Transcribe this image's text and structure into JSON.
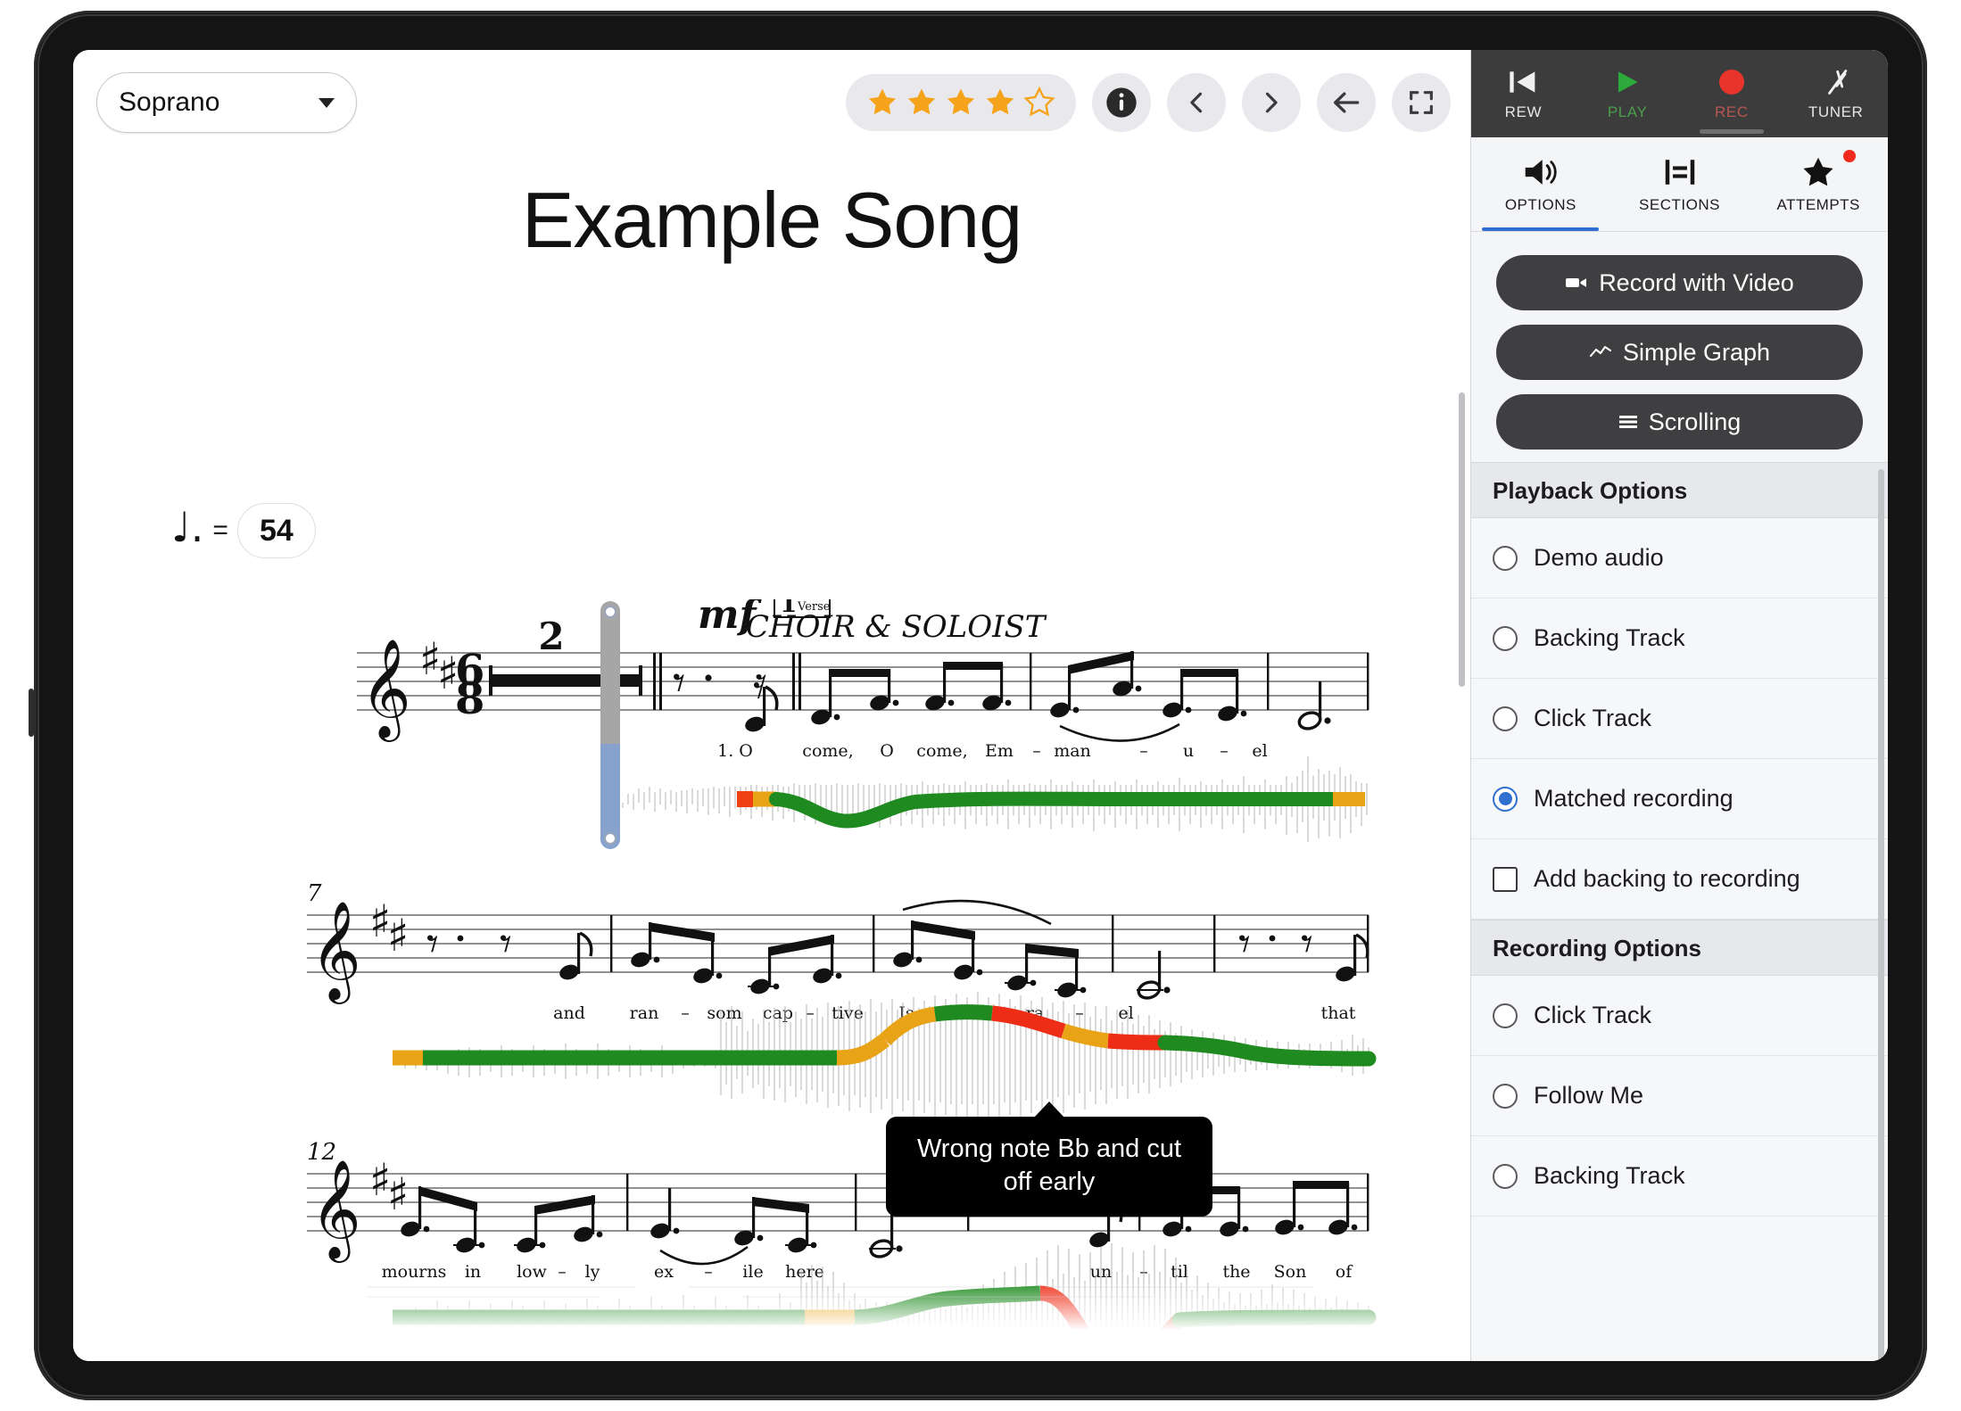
{
  "score": {
    "voice_part": "Soprano",
    "title": "Example Song",
    "tempo": {
      "note": "♩.",
      "equals": "=",
      "bpm": "54"
    },
    "rating": {
      "filled": 4,
      "total": 5,
      "color": "#f5a31a"
    },
    "systems": [
      {
        "measure_number": "",
        "key_signature_sharps": 2,
        "time_signature": "6/8",
        "multimeasure_rest": "2",
        "dynamic": "mf",
        "verse_box": "1",
        "verse_box_sub": "Verse",
        "section_label": "CHOIR & SOLOIST",
        "lyrics": [
          "1. O",
          "come,",
          "O",
          "come,",
          "Em",
          "–",
          "man",
          "–",
          "u",
          "–",
          "el"
        ]
      },
      {
        "measure_number": "7",
        "key_signature_sharps": 2,
        "lyrics": [
          "and",
          "ran",
          "–",
          "som",
          "cap",
          "–",
          "tive",
          "Is",
          "–",
          "ra",
          "–",
          "el",
          "that"
        ]
      },
      {
        "measure_number": "12",
        "key_signature_sharps": 2,
        "lyrics": [
          "mourns",
          "in",
          "low",
          "–",
          "ly",
          "ex",
          "–",
          "ile",
          "here",
          "un",
          "–",
          "til",
          "the",
          "Son",
          "of"
        ]
      }
    ],
    "annotation": {
      "text": "Wrong note Bb and cut off early"
    },
    "toolbar": {
      "info_label": "info-icon",
      "prev_label": "‹",
      "next_label": "›",
      "back_label": "back-arrow-icon",
      "fullscreen_label": "fullscreen-icon"
    }
  },
  "panel": {
    "transport": [
      {
        "id": "rew",
        "label": "REW",
        "icon": "rewind-to-start"
      },
      {
        "id": "play",
        "label": "PLAY",
        "icon": "play-triangle"
      },
      {
        "id": "rec",
        "label": "REC",
        "icon": "record-circle"
      },
      {
        "id": "tuner",
        "label": "TUNER",
        "icon": "tuning-fork"
      }
    ],
    "tabs": [
      {
        "id": "options",
        "label": "OPTIONS",
        "icon": "speaker-icon",
        "active": true,
        "badge": false
      },
      {
        "id": "sections",
        "label": "SECTIONS",
        "icon": "sections-icon",
        "active": false,
        "badge": false
      },
      {
        "id": "attempts",
        "label": "ATTEMPTS",
        "icon": "star-icon",
        "active": false,
        "badge": true
      }
    ],
    "actions": [
      {
        "id": "record-with-video",
        "label": "Record with Video",
        "icon": "video-camera-icon"
      },
      {
        "id": "simple-graph",
        "label": "Simple Graph",
        "icon": "line-chart-icon"
      },
      {
        "id": "scrolling",
        "label": "Scrolling",
        "icon": "lines-icon"
      }
    ],
    "playback_section": {
      "header": "Playback Options",
      "options": [
        {
          "id": "demo-audio",
          "label": "Demo audio",
          "type": "radio",
          "checked": false
        },
        {
          "id": "backing-track",
          "label": "Backing Track",
          "type": "radio",
          "checked": false
        },
        {
          "id": "click-track",
          "label": "Click Track",
          "type": "radio",
          "checked": false
        },
        {
          "id": "matched-recording",
          "label": "Matched recording",
          "type": "radio",
          "checked": true
        },
        {
          "id": "add-backing",
          "label": "Add backing to recording",
          "type": "checkbox",
          "checked": false
        }
      ]
    },
    "recording_section": {
      "header": "Recording Options",
      "options": [
        {
          "id": "rec-click-track",
          "label": "Click Track",
          "type": "radio",
          "checked": false
        },
        {
          "id": "rec-follow-me",
          "label": "Follow Me",
          "type": "radio",
          "checked": false
        },
        {
          "id": "rec-backing-track",
          "label": "Backing Track",
          "type": "radio",
          "checked": false
        }
      ]
    }
  },
  "colors": {
    "accent_blue": "#2f6fd0",
    "record_red": "#e8342a",
    "play_green": "#2eaa3c",
    "pitch_good": "#1f8a1f",
    "pitch_warn": "#e8a317",
    "pitch_bad": "#ee2d16",
    "star_gold": "#f5a31a",
    "panel_dark": "#3c3c3c"
  }
}
